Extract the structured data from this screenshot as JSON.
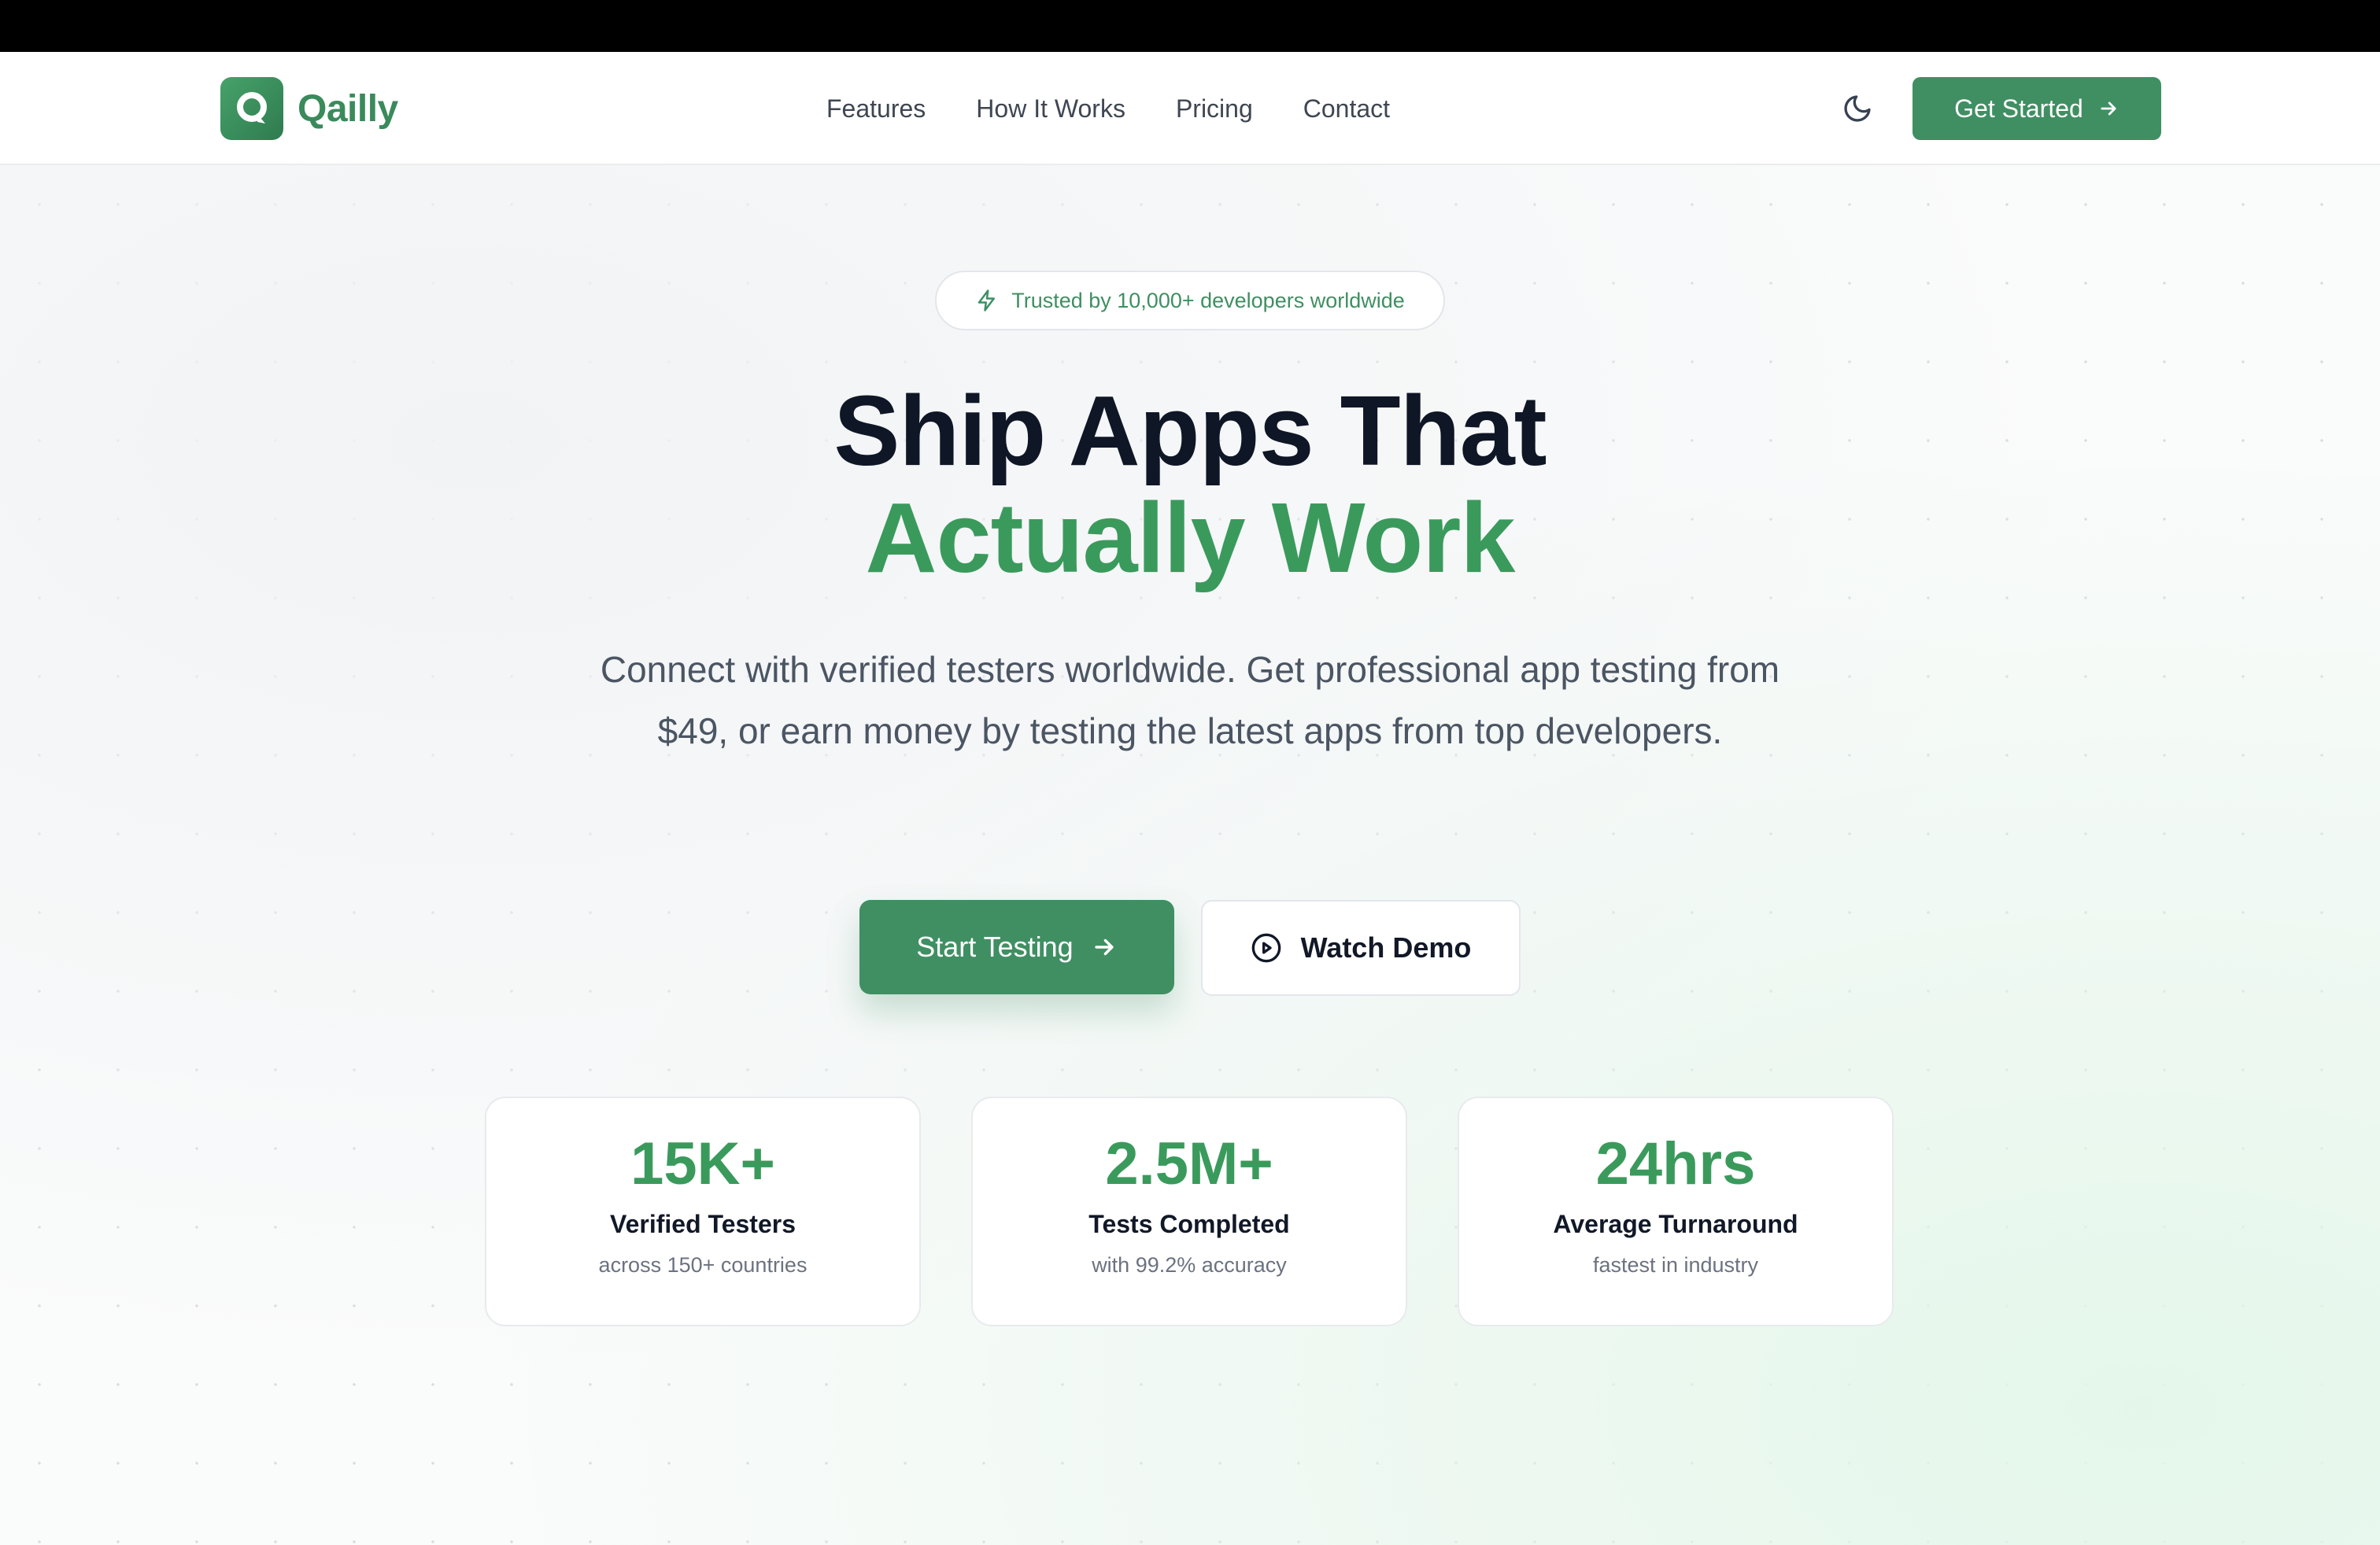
{
  "brand": {
    "name": "Qailly",
    "accent": "#3f8f62"
  },
  "nav": {
    "links": [
      "Features",
      "How It Works",
      "Pricing",
      "Contact"
    ],
    "theme_icon": "moon-icon",
    "cta_label": "Get Started"
  },
  "hero": {
    "badge": "Trusted by 10,000+ developers worldwide",
    "headline_line1": "Ship Apps That",
    "headline_line2": "Actually Work",
    "subtitle": "Connect with verified testers worldwide. Get professional app testing from $49, or earn money by testing the latest apps from top developers.",
    "primary_cta": "Start Testing",
    "secondary_cta": "Watch Demo"
  },
  "stats": [
    {
      "value": "15K+",
      "label": "Verified Testers",
      "sub": "across 150+ countries"
    },
    {
      "value": "2.5M+",
      "label": "Tests Completed",
      "sub": "with 99.2% accuracy"
    },
    {
      "value": "24hrs",
      "label": "Average Turnaround",
      "sub": "fastest in industry"
    }
  ]
}
